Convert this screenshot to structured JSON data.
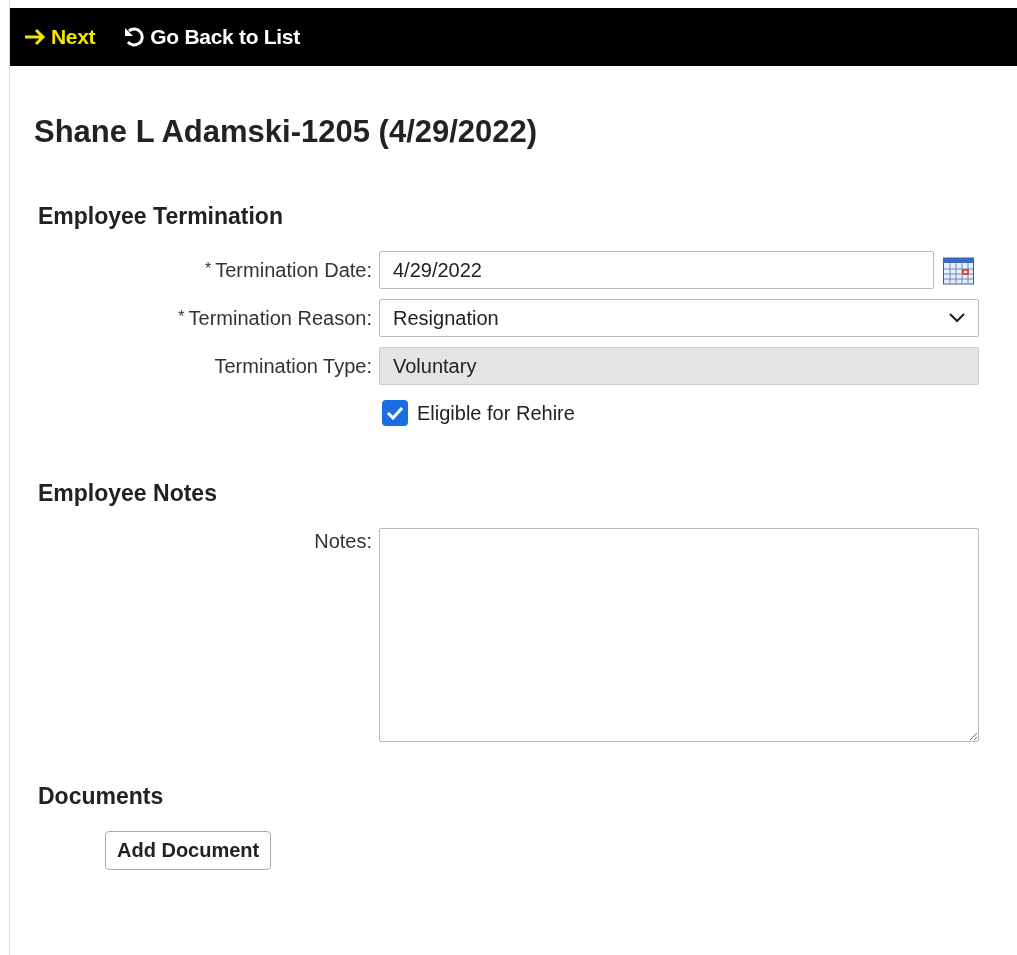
{
  "toolbar": [
    {
      "kind": "next",
      "label": "Next"
    },
    {
      "kind": "back",
      "label": "Go Back to List"
    }
  ],
  "title": "Shane L Adamski-1205 (4/29/2022)",
  "sections": [
    {
      "heading": "Employee Termination",
      "fields": [
        {
          "kind": "date",
          "required_mark": "*",
          "label": "Termination Date:",
          "value": "4/29/2022"
        },
        {
          "kind": "select",
          "required_mark": "*",
          "label": "Termination Reason:",
          "value": "Resignation"
        },
        {
          "kind": "readonly",
          "label": "Termination Type:",
          "value": "Voluntary"
        },
        {
          "kind": "checkbox",
          "label": "Eligible for Rehire",
          "checked": true
        }
      ]
    },
    {
      "heading": "Employee Notes",
      "fields": [
        {
          "kind": "textarea",
          "label": "Notes:"
        }
      ]
    },
    {
      "heading": "Documents",
      "fields": [
        {
          "kind": "button",
          "label": "Add Document"
        }
      ]
    }
  ]
}
